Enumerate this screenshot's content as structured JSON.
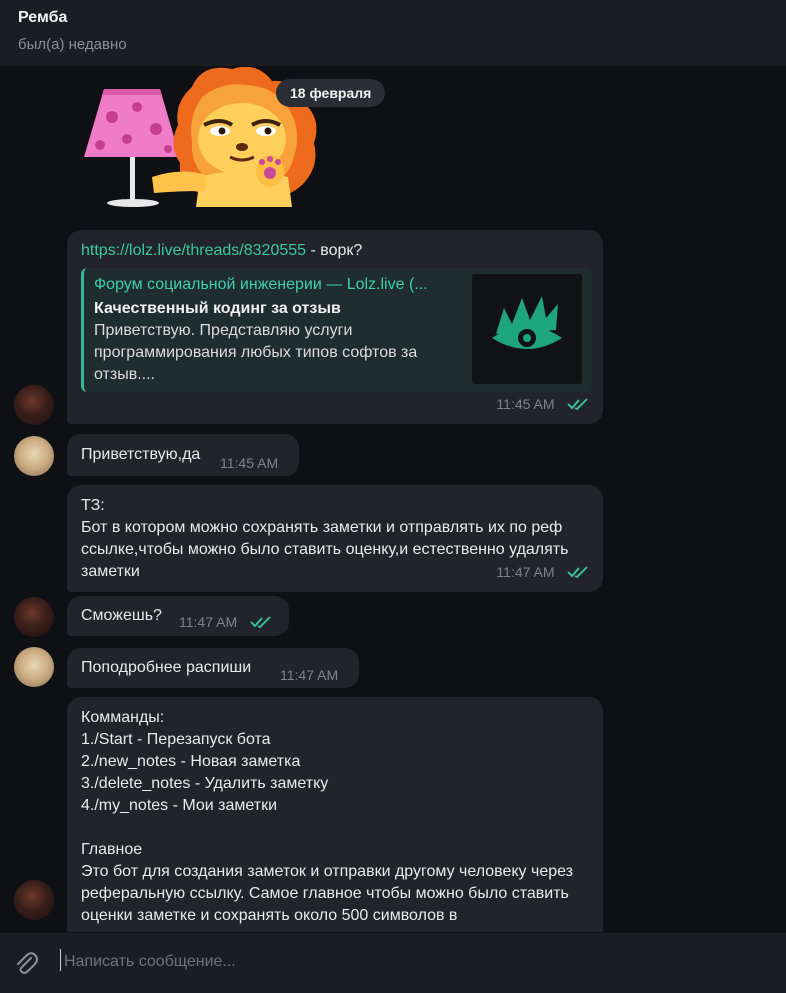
{
  "header": {
    "name": "Ремба",
    "status": "был(а) недавно"
  },
  "date_divider": "18 февраля",
  "messages": {
    "m1": {
      "link": "https://lolz.live/threads/8320555",
      "text": " - ворк?",
      "preview": {
        "site": "Форум социальной инженерии — Lolz.live (...",
        "title": "Качественный кодинг за отзыв",
        "description": "Приветствую. Представляю услуги программирования любых типов софтов за отзыв...."
      },
      "time": "11:45 AM"
    },
    "m2": {
      "text": "Приветствую,да",
      "time": "11:45 AM"
    },
    "m3": {
      "text": "ТЗ:\nБот в котором можно сохранять заметки и отправлять их по реф ссылке,чтобы можно было ставить оценку,и естественно удалять заметки",
      "time": "11:47 AM"
    },
    "m4": {
      "text": "Сможешь?",
      "time": "11:47 AM"
    },
    "m5": {
      "text": "Поподробнее распиши",
      "time": "11:47 AM"
    },
    "m6": {
      "text": "Комманды:\n1./Start - Перезапуск бота\n2./new_notes - Новая заметка\n3./delete_notes - Удалить заметку\n4./my_notes - Мои заметки\n\nГлавное\nЭто бот для создания заметок и отправки другому человеку через реферальную ссылку. Самое главное чтобы можно было ставить оценки заметке и сохранять около 500 символов в"
    }
  },
  "composer": {
    "placeholder": "Написать сообщение..."
  },
  "colors": {
    "accent": "#39c7a6",
    "bubble": "#212428",
    "background": "#0e1014"
  },
  "icons": {
    "attach": "paperclip-icon",
    "read": "double-check-icon"
  }
}
